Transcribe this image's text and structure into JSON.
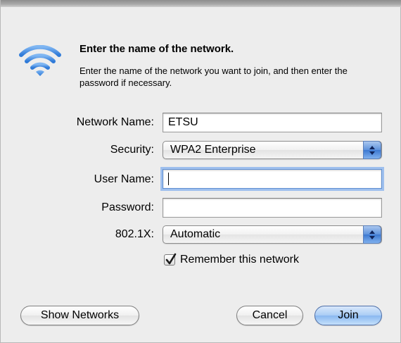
{
  "header": {
    "title": "Enter the name of the network.",
    "description": "Enter the name of the network you want to join, and then enter the password if necessary."
  },
  "form": {
    "network_name_label": "Network Name:",
    "network_name_value": "ETSU",
    "security_label": "Security:",
    "security_value": "WPA2 Enterprise",
    "username_label": "User Name:",
    "username_value": "",
    "password_label": "Password:",
    "password_value": "",
    "dot1x_label": "802.1X:",
    "dot1x_value": "Automatic",
    "remember_label": "Remember this network",
    "remember_checked": true
  },
  "buttons": {
    "show_networks": "Show Networks",
    "cancel": "Cancel",
    "join": "Join"
  },
  "colors": {
    "wifi_icon": "#4a8fe0",
    "focus_ring": "#9fc0ee",
    "popup_arrow": "#3c78d1"
  },
  "icons": {
    "wifi": "wifi-icon",
    "popup_arrows": "updown-arrows-icon",
    "checkmark": "checkmark-icon"
  }
}
